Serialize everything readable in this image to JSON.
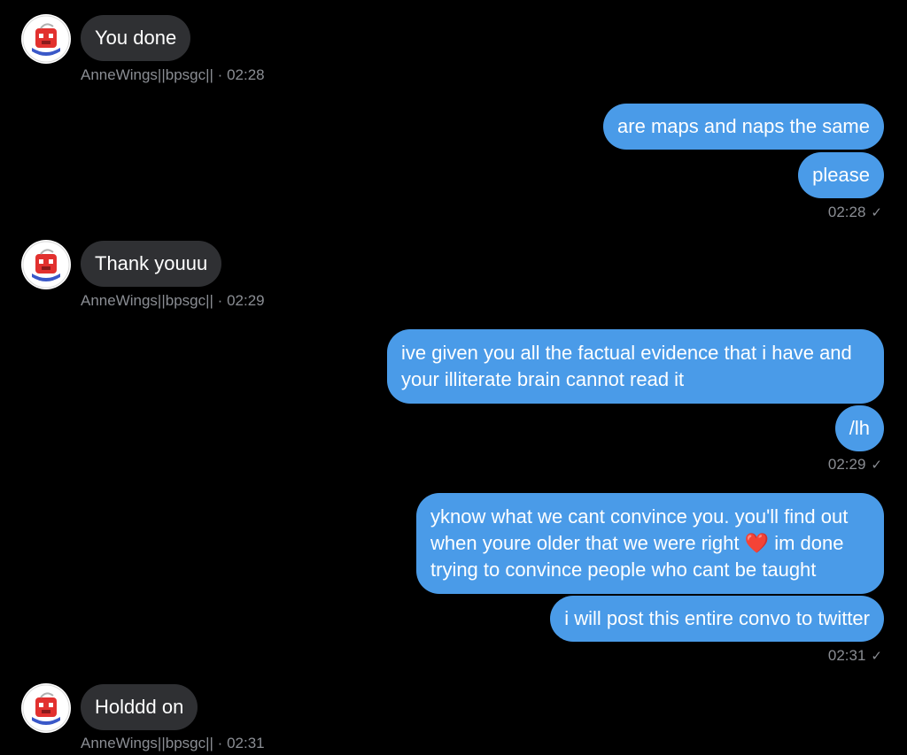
{
  "conversation": {
    "participant_name": "AnneWings||bpsgc||",
    "messages": [
      {
        "text": "You done",
        "meta": "AnneWings||bpsgc|| · 02:28"
      },
      {
        "text": "are maps and naps the same"
      },
      {
        "text": "please",
        "meta": "02:28"
      },
      {
        "text": "Thank youuu",
        "meta": "AnneWings||bpsgc|| · 02:29"
      },
      {
        "text_line1": "ive given you all the factual evidence that i have and",
        "text_line2": "your illiterate brain cannot read it"
      },
      {
        "text": "/lh",
        "meta": "02:29"
      },
      {
        "text_line1": "yknow what we cant convince you. you'll find out",
        "text_line2a": "when youre older that we were right",
        "heart": "❤️",
        "text_line2b": "im done",
        "text_line3": "trying to convince people who cant be taught"
      },
      {
        "text": "i will post this entire convo to twitter",
        "meta": "02:31"
      },
      {
        "text": "Holddd on",
        "meta": "AnneWings||bpsgc|| · 02:31"
      }
    ]
  },
  "colors": {
    "background": "#000000",
    "incoming_bubble": "#2f3033",
    "outgoing_bubble": "#4a9be8",
    "meta_text": "#8a8d93"
  },
  "icons": {
    "read_check": "checkmark-icon",
    "avatar": "avatar-icon"
  }
}
